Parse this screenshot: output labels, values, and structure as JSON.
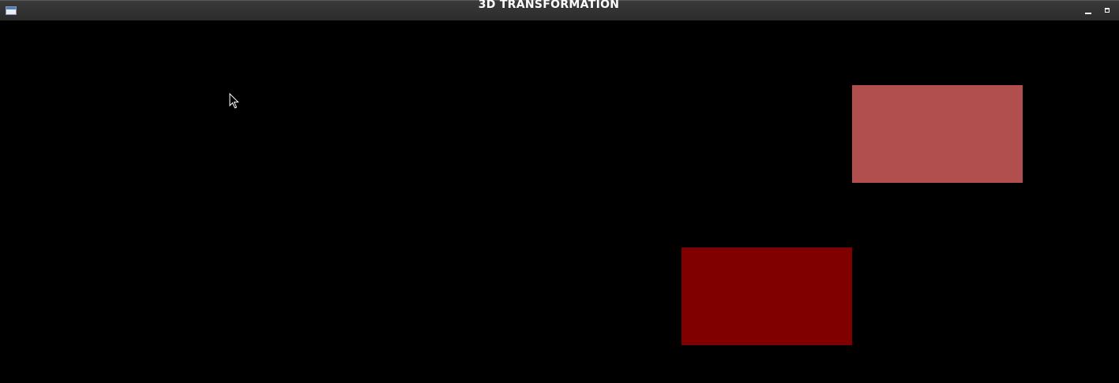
{
  "window": {
    "title": "3D TRANSFORMATION",
    "icon": "app-window-icon",
    "controls": [
      "minimize-icon",
      "maximize-icon"
    ]
  },
  "canvas": {
    "background": "#000000",
    "shapes": [
      {
        "name": "translated-rectangle",
        "color": "#b14e4e"
      },
      {
        "name": "original-rectangle",
        "color": "#800000"
      }
    ]
  },
  "cursor": {
    "icon": "mouse-pointer-icon"
  }
}
